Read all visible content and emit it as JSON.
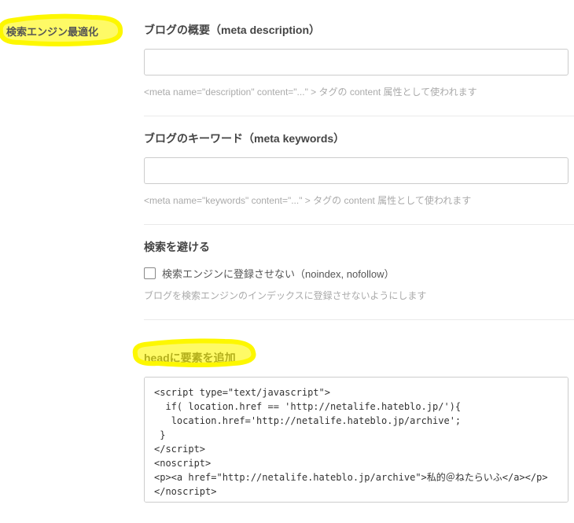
{
  "sidebar": {
    "title": "検索エンジン最適化"
  },
  "sections": {
    "description": {
      "title": "ブログの概要（meta description）",
      "value": "",
      "help": "<meta name=\"description\" content=\"...\" > タグの content 属性として使われます"
    },
    "keywords": {
      "title": "ブログのキーワード（meta keywords）",
      "value": "",
      "help": "<meta name=\"keywords\" content=\"...\" > タグの content 属性として使われます"
    },
    "noindex": {
      "title": "検索を避ける",
      "checkboxLabel": "検索エンジンに登録させない（noindex, nofollow）",
      "info": "ブログを検索エンジンのインデックスに登録させないようにします"
    },
    "head": {
      "title": "headに要素を追加",
      "code": "<script type=\"text/javascript\">\n  if( location.href == 'http://netalife.hateblo.jp/'){\n   location.href='http://netalife.hateblo.jp/archive';\n }\n</script>\n<noscript>\n<p><a href=\"http://netalife.hateblo.jp/archive\">私的＠ねたらいふ</a></p>\n</noscript>"
    }
  }
}
